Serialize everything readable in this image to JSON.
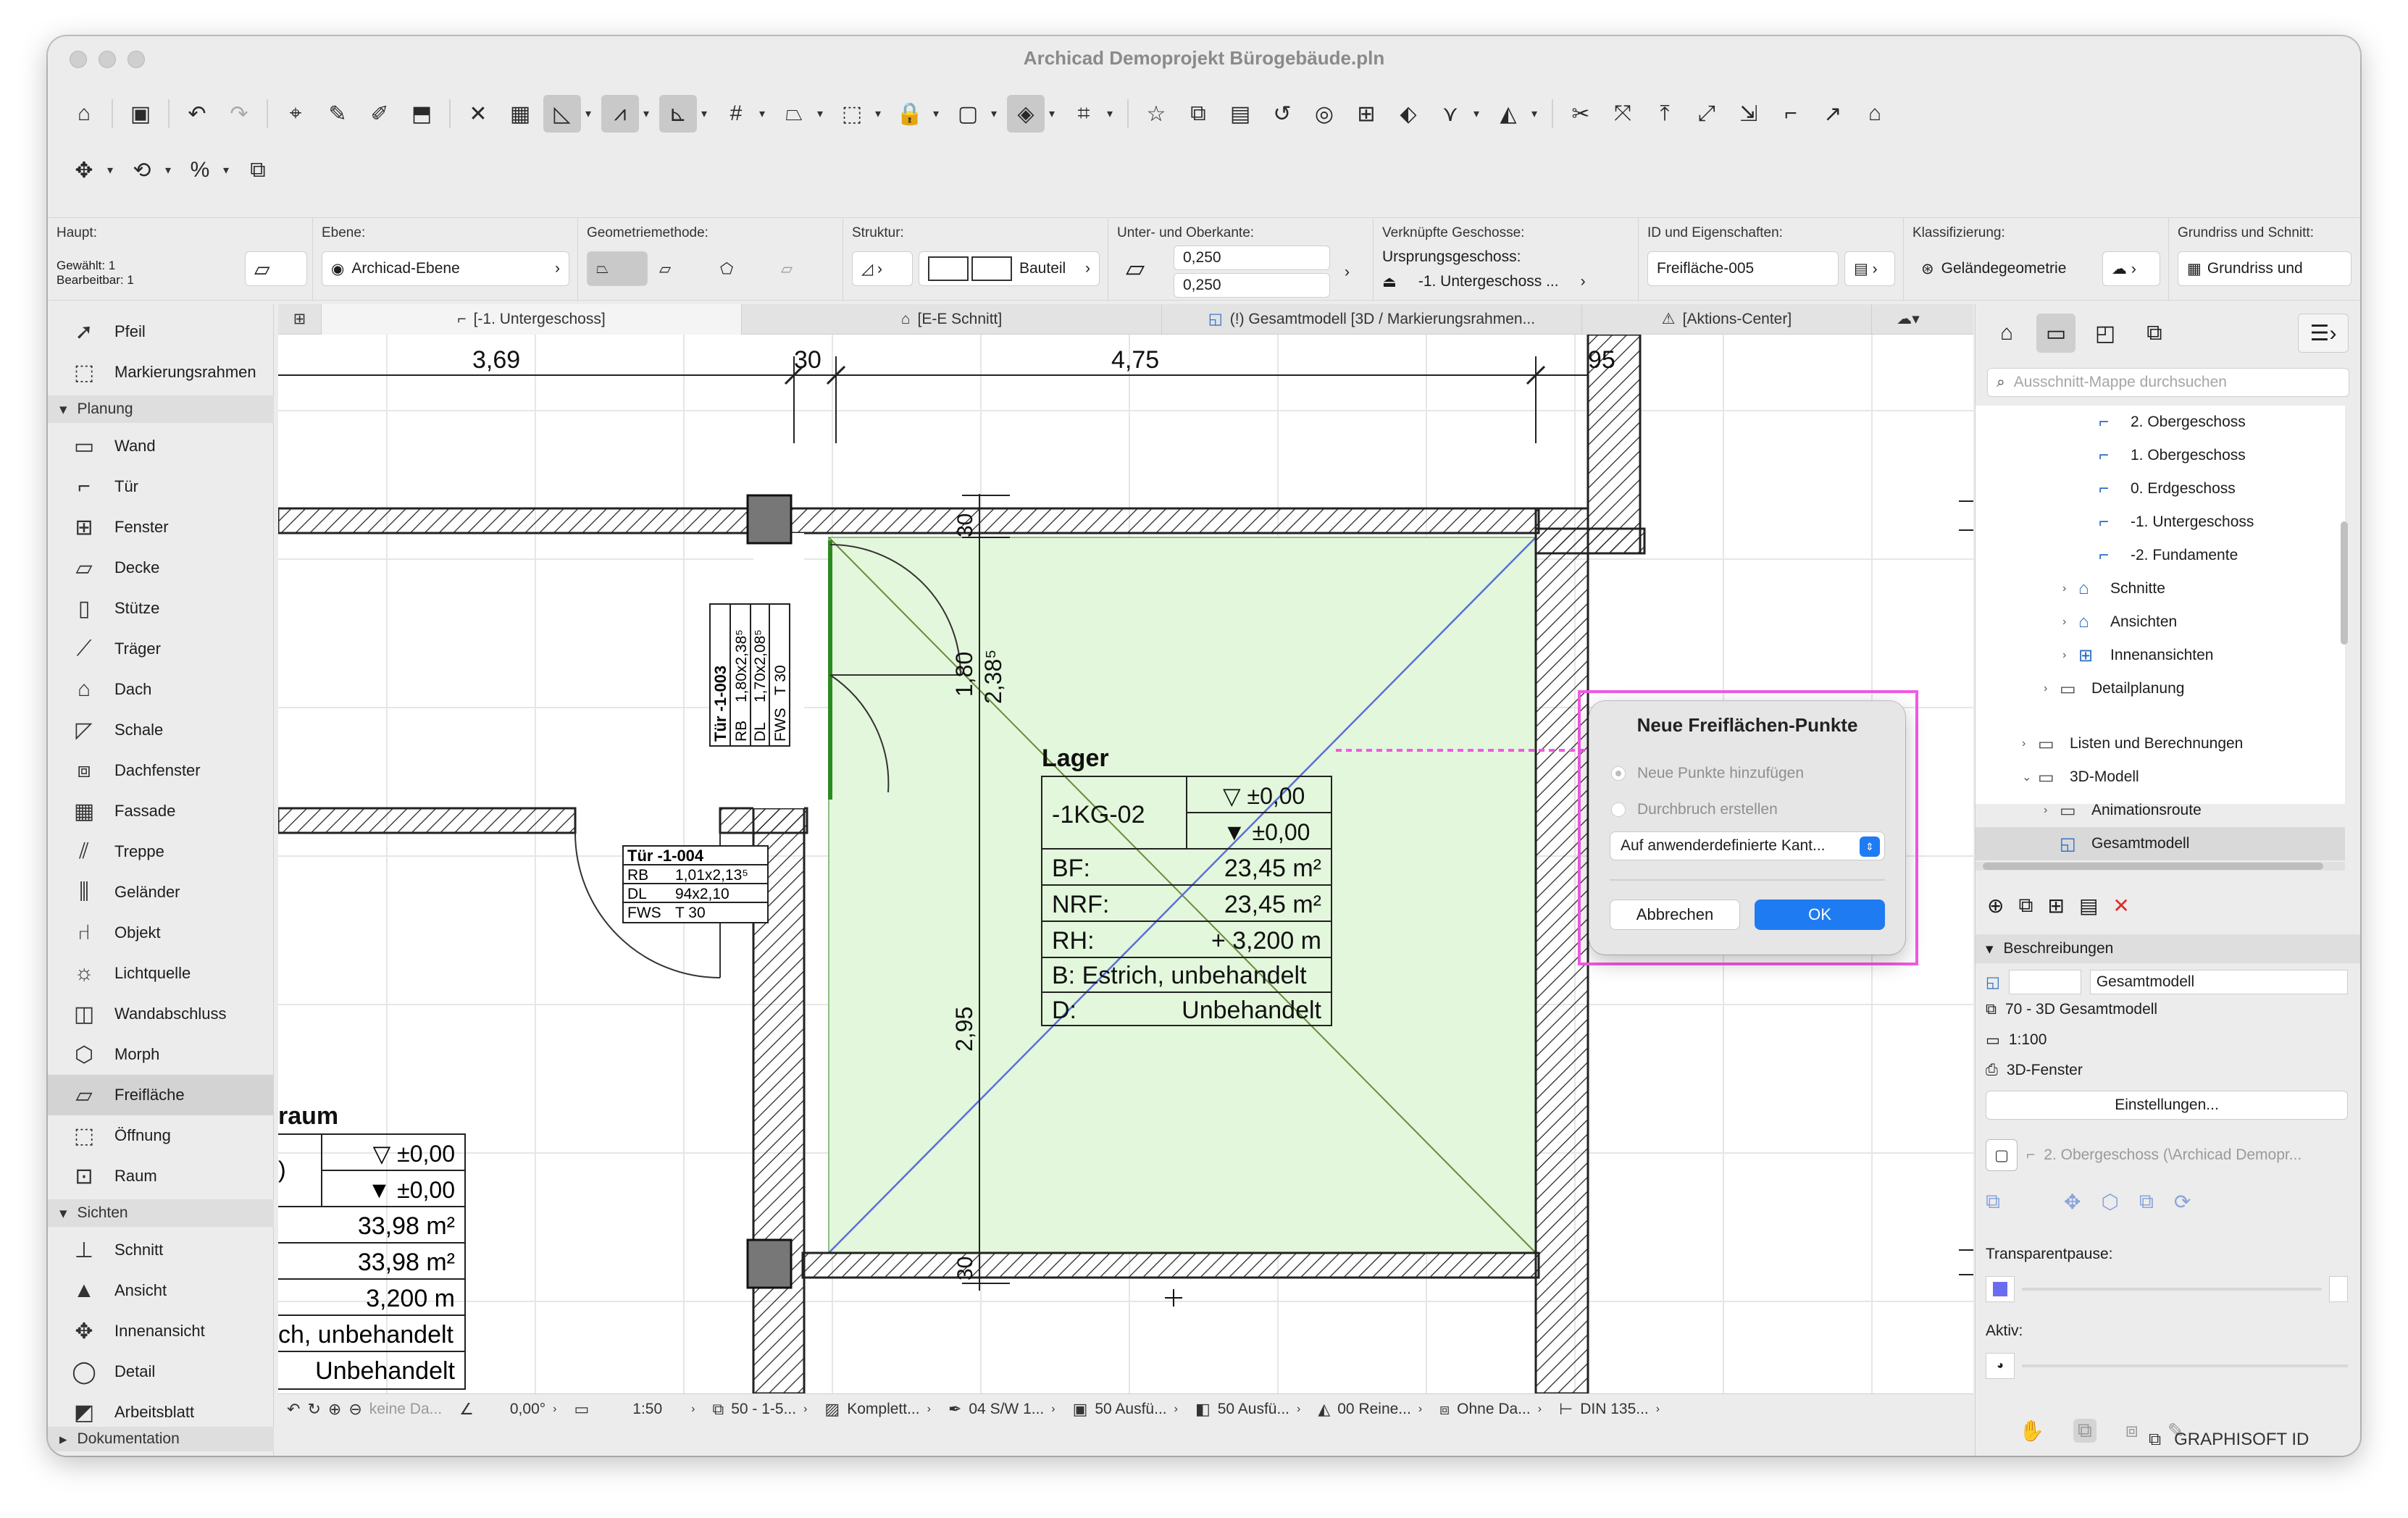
{
  "window": {
    "title": "Archicad Demoprojekt Bürogebäude.pln"
  },
  "infobox": {
    "haupt_label": "Haupt:",
    "gewaehlt": "Gewählt: 1",
    "bearbeitbar": "Bearbeitbar: 1",
    "ebene_label": "Ebene:",
    "ebene_value": "Archicad-Ebene",
    "geometrie_label": "Geometriemethode:",
    "struktur_label": "Struktur:",
    "struktur_value": "Bauteil",
    "kante_label": "Unter- und Oberkante:",
    "kante_top": "0,250",
    "kante_bottom": "0,250",
    "geschosse_label": "Verknüpfte Geschosse:",
    "ursprung_label": "Ursprungsgeschoss:",
    "ursprung_value": "-1. Untergeschoss ...",
    "id_label": "ID und Eigenschaften:",
    "id_value": "Freifläche-005",
    "klass_label": "Klassifizierung:",
    "klass_value": "Geländegeometrie",
    "grundriss_label": "Grundriss und Schnitt:",
    "grundriss_value": "Grundriss und"
  },
  "toolbox": {
    "top": [
      "Pfeil",
      "Markierungsrahmen"
    ],
    "group_planung": "Planung",
    "planung": [
      "Wand",
      "Tür",
      "Fenster",
      "Decke",
      "Stütze",
      "Träger",
      "Dach",
      "Schale",
      "Dachfenster",
      "Fassade",
      "Treppe",
      "Geländer",
      "Objekt",
      "Lichtquelle",
      "Wandabschluss",
      "Morph",
      "Freifläche",
      "Öffnung",
      "Raum"
    ],
    "group_sichten": "Sichten",
    "sichten": [
      "Schnitt",
      "Ansicht",
      "Innenansicht",
      "Detail",
      "Arbeitsblatt"
    ],
    "group_doku": "Dokumentation"
  },
  "tabs": [
    "[-1. Untergeschoss]",
    "[E-E Schnitt]",
    "(!) Gesamtmodell [3D / Markierungsrahmen...",
    "[Aktions-Center]"
  ],
  "drawing": {
    "dims": [
      "3,69",
      "30",
      "4,75",
      "95"
    ],
    "vdim_a": "1,80",
    "vdim_b": "2,38⁵",
    "vdim_30a": "30",
    "vdim_295": "2,95",
    "vdim_30b": "30",
    "room_name": "Lager",
    "room_id": "-1KG-02",
    "level1": "▽ ±0,00",
    "level2": "▼ ±0,00",
    "bf": "BF:",
    "bf_val": "23,45 m²",
    "nrf": "NRF:",
    "nrf_val": "23,45 m²",
    "rh": "RH:",
    "rh_val": "+ 3,200 m",
    "b_text": "B: Estrich, unbehandelt",
    "d_label": "D:",
    "d_val": "Unbehandelt",
    "door1": [
      "Tür -1-003",
      "RB",
      "1,80x2,38⁵",
      "DL",
      "1,70x2,08⁵",
      "FWS",
      "T 30"
    ],
    "door2": [
      "Tür -1-004",
      "RB",
      "1,01x2,13⁵",
      "DL",
      "94x2,10",
      "FWS",
      "T 30"
    ],
    "room2_name": "raum",
    "room2_l1": "▽ ±0,00",
    "room2_l2": "▼ ±0,00",
    "room2_bf": "33,98 m²",
    "room2_nrf": "33,98 m²",
    "room2_rh": "3,200 m",
    "room2_b": "ch, unbehandelt",
    "room2_d": "Unbehandelt",
    "room2_id": ")"
  },
  "statusbar": [
    "keine Da...",
    "0,00°",
    "1:50",
    "50 - 1-5...",
    "Komplett...",
    "04 S/W 1...",
    "50 Ausfü...",
    "50 Ausfü...",
    "00 Reine...",
    "Ohne Da...",
    "DIN 135..."
  ],
  "navigator": {
    "search_placeholder": "Ausschnitt-Mappe durchsuchen",
    "tree": [
      "2. Obergeschoss",
      "1. Obergeschoss",
      "0. Erdgeschoss",
      "-1. Untergeschoss",
      "-2. Fundamente",
      "Schnitte",
      "Ansichten",
      "Innenansichten",
      "Detailplanung",
      "Listen und Berechnungen",
      "3D-Modell",
      "Animationsroute",
      "Gesamtmodell"
    ],
    "beschreibungen": "Beschreibungen",
    "name_value": "Gesamtmodell",
    "row1": "70 - 3D Gesamtmodell",
    "row2": "1:100",
    "row3": "3D-Fenster",
    "einstellungen": "Einstellungen...",
    "layout_value": "2. Obergeschoss (\\Archicad Demopr...",
    "transparent": "Transparentpause:",
    "aktiv": "Aktiv:",
    "graphisoft": "GRAPHISOFT ID"
  },
  "dialog": {
    "title": "Neue Freiflächen-Punkte",
    "opt1": "Neue Punkte hinzufügen",
    "opt2": "Durchbruch erstellen",
    "select_value": "Auf anwenderdefinierte Kant...",
    "cancel": "Abbrechen",
    "ok": "OK"
  },
  "colors": {
    "accent": "#1f7bf2",
    "highlight": "#f25ae3",
    "fill": "#e5f8df"
  }
}
